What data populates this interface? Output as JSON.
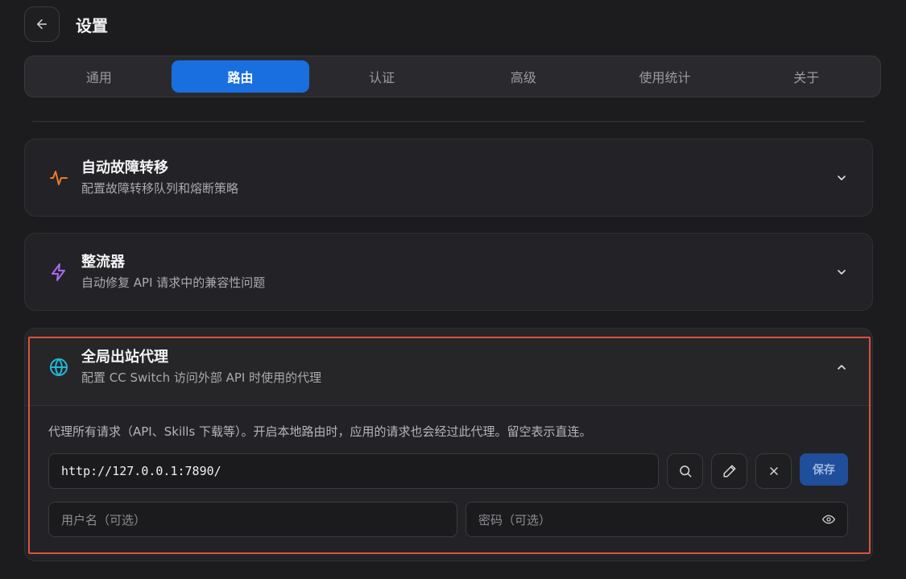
{
  "header": {
    "title": "设置"
  },
  "tabs": [
    {
      "label": "通用"
    },
    {
      "label": "路由",
      "active": true
    },
    {
      "label": "认证"
    },
    {
      "label": "高级"
    },
    {
      "label": "使用统计"
    },
    {
      "label": "关于"
    }
  ],
  "sections": {
    "failover": {
      "title": "自动故障转移",
      "subtitle": "配置故障转移队列和熔断策略",
      "icon": "activity-icon",
      "color": "#f07a2a"
    },
    "rectifier": {
      "title": "整流器",
      "subtitle": "自动修复 API 请求中的兼容性问题",
      "icon": "zap-icon",
      "color": "#a56bf0"
    },
    "proxy": {
      "title": "全局出站代理",
      "subtitle": "配置 CC Switch 访问外部 API 时使用的代理",
      "icon": "globe-icon",
      "color": "#22b8d6",
      "description": "代理所有请求（API、Skills 下载等）。开启本地路由时，应用的请求也会经过此代理。留空表示直连。",
      "url_value": "http://127.0.0.1:7890/",
      "username_placeholder": "用户名（可选）",
      "password_placeholder": "密码（可选）",
      "save_label": "保存"
    }
  },
  "colors": {
    "accent": "#1a6fe0",
    "highlight": "#d9533a"
  }
}
